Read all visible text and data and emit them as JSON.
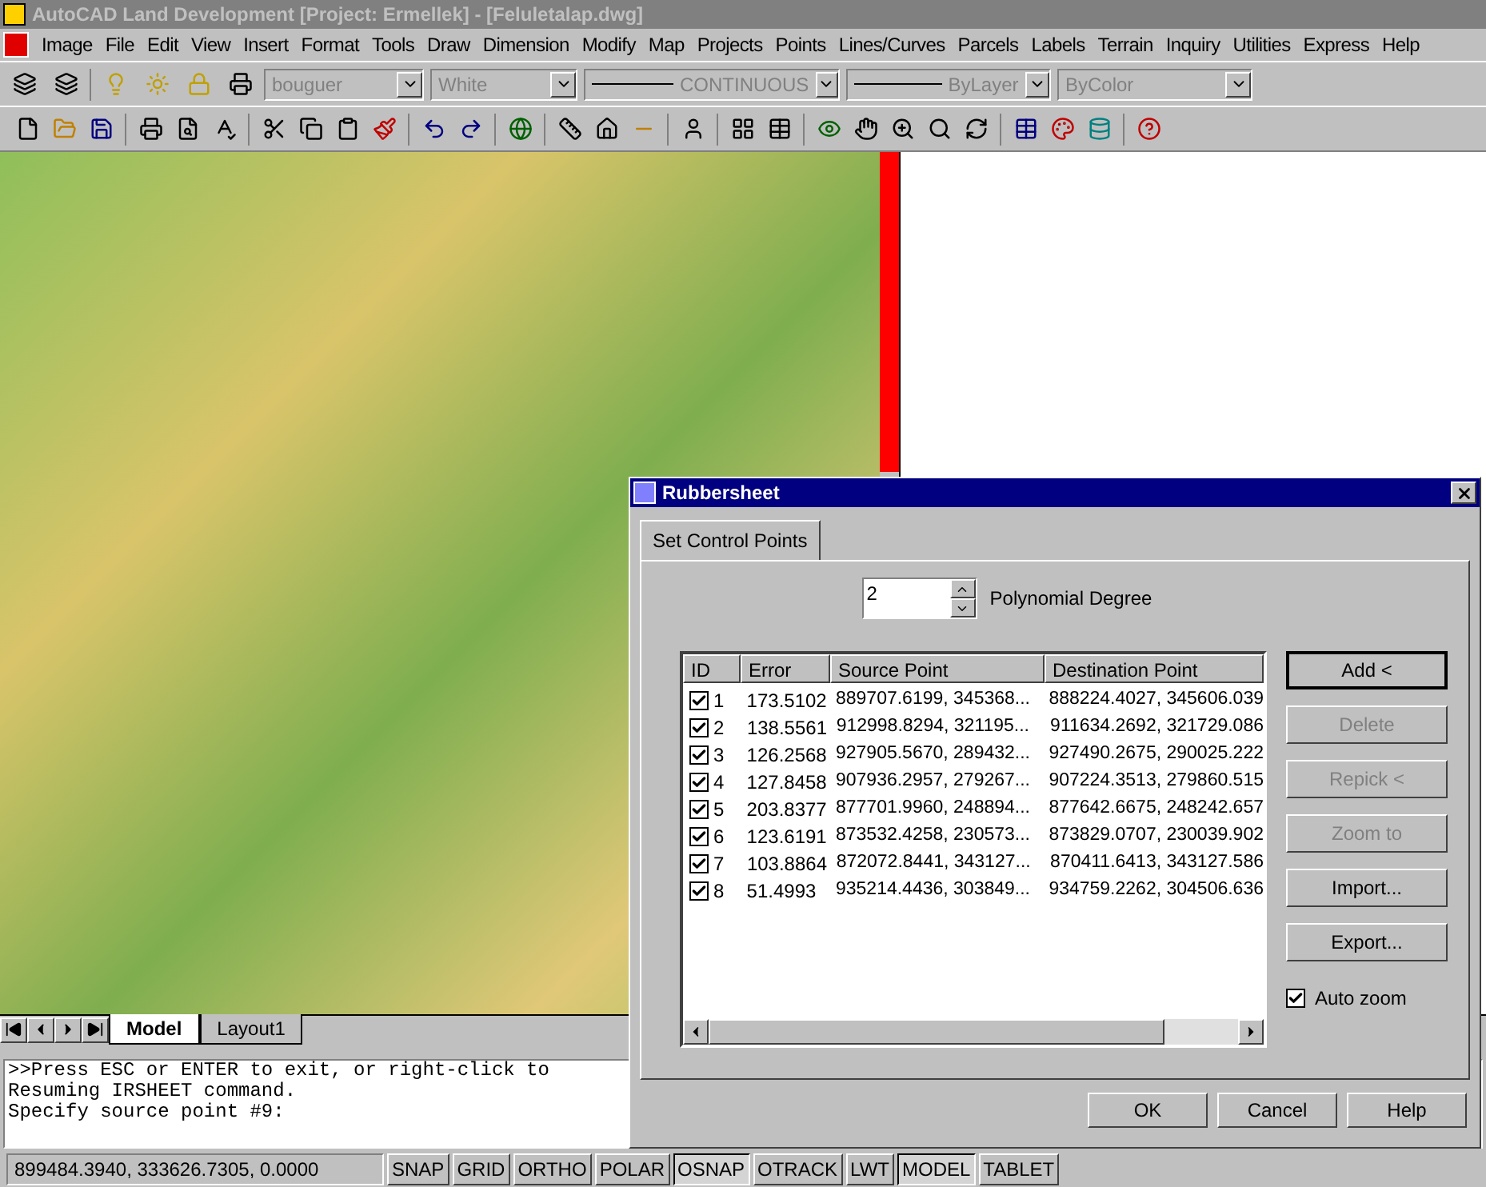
{
  "window": {
    "title": "AutoCAD Land Development [Project: Ermellek] - [Feluletalap.dwg]"
  },
  "menu": [
    "Image",
    "File",
    "Edit",
    "View",
    "Insert",
    "Format",
    "Tools",
    "Draw",
    "Dimension",
    "Modify",
    "Map",
    "Projects",
    "Points",
    "Lines/Curves",
    "Parcels",
    "Labels",
    "Terrain",
    "Inquiry",
    "Utilities",
    "Express",
    "Help"
  ],
  "properties_toolbar": {
    "layer": "bouguer",
    "color_field": "White",
    "linetype": "CONTINUOUS",
    "lineweight": "ByLayer",
    "plot_style": "ByColor"
  },
  "layout_tabs": [
    {
      "label": "Model",
      "selected": true
    },
    {
      "label": "Layout1",
      "selected": false
    }
  ],
  "command_lines": [
    ">>Press ESC or ENTER to exit, or right-click to",
    "Resuming IRSHEET command.",
    "Specify source point #9:"
  ],
  "status_bar": {
    "coordinates": "899484.3940, 333626.7305, 0.0000",
    "toggles": [
      {
        "label": "SNAP",
        "on": false
      },
      {
        "label": "GRID",
        "on": false
      },
      {
        "label": "ORTHO",
        "on": false
      },
      {
        "label": "POLAR",
        "on": false
      },
      {
        "label": "OSNAP",
        "on": true
      },
      {
        "label": "OTRACK",
        "on": false
      },
      {
        "label": "LWT",
        "on": false
      },
      {
        "label": "MODEL",
        "on": true
      },
      {
        "label": "TABLET",
        "on": false
      }
    ]
  },
  "dialog": {
    "title": "Rubbersheet",
    "tab": "Set Control Points",
    "degree": "2",
    "degree_label": "Polynomial Degree",
    "columns": [
      "ID",
      "Error",
      "Source Point",
      "Destination Point"
    ],
    "rows": [
      {
        "checked": true,
        "id": "1",
        "error": "173.5102",
        "source": "889707.6199, 345368...",
        "destination": "888224.4027, 345606.039"
      },
      {
        "checked": true,
        "id": "2",
        "error": "138.5561",
        "source": "912998.8294, 321195...",
        "destination": "911634.2692, 321729.086"
      },
      {
        "checked": true,
        "id": "3",
        "error": "126.2568",
        "source": "927905.5670, 289432...",
        "destination": "927490.2675, 290025.222"
      },
      {
        "checked": true,
        "id": "4",
        "error": "127.8458",
        "source": "907936.2957, 279267...",
        "destination": "907224.3513, 279860.515"
      },
      {
        "checked": true,
        "id": "5",
        "error": "203.8377",
        "source": "877701.9960, 248894...",
        "destination": "877642.6675, 248242.657"
      },
      {
        "checked": true,
        "id": "6",
        "error": "123.6191",
        "source": "873532.4258, 230573...",
        "destination": "873829.0707, 230039.902"
      },
      {
        "checked": true,
        "id": "7",
        "error": "103.8864",
        "source": "872072.8441, 343127...",
        "destination": "870411.6413, 343127.586"
      },
      {
        "checked": true,
        "id": "8",
        "error": "51.4993",
        "source": "935214.4436, 303849...",
        "destination": "934759.2262, 304506.636"
      }
    ],
    "side_buttons": [
      {
        "label": "Add <",
        "disabled": false
      },
      {
        "label": "Delete",
        "disabled": true
      },
      {
        "label": "Repick <",
        "disabled": true
      },
      {
        "label": "Zoom to",
        "disabled": true
      },
      {
        "label": "Import...",
        "disabled": false
      },
      {
        "label": "Export...",
        "disabled": false
      }
    ],
    "auto_zoom": {
      "label": "Auto zoom",
      "checked": true
    },
    "footer_buttons": [
      "OK",
      "Cancel",
      "Help"
    ]
  }
}
